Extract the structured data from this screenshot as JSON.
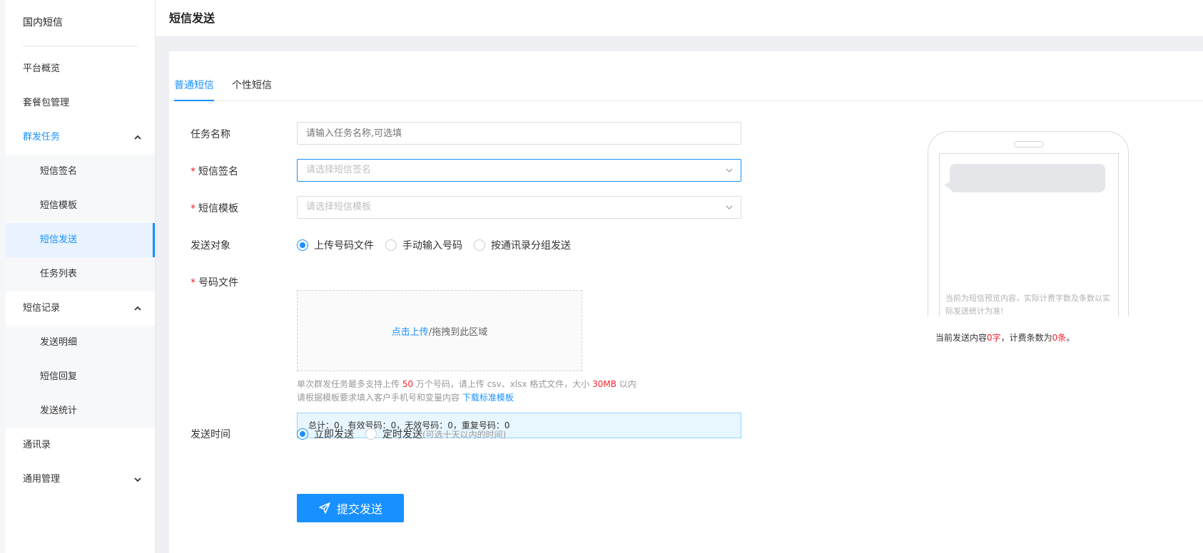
{
  "sidebar": {
    "title": "国内短信",
    "items": [
      {
        "label": "平台概览"
      },
      {
        "label": "套餐包管理"
      },
      {
        "label": "群发任务",
        "children": [
          "短信签名",
          "短信模板",
          "短信发送",
          "任务列表"
        ]
      },
      {
        "label": "短信记录",
        "children": [
          "发送明细",
          "短信回复",
          "发送统计"
        ]
      },
      {
        "label": "通讯录"
      },
      {
        "label": "通用管理"
      }
    ],
    "active_item": "短信发送"
  },
  "header": {
    "title": "短信发送"
  },
  "tabs": [
    {
      "label": "普通短信",
      "active": true
    },
    {
      "label": "个性短信",
      "active": false
    }
  ],
  "form": {
    "task_name": {
      "label": "任务名称",
      "placeholder": "请输入任务名称,可选填"
    },
    "signature": {
      "label": "短信签名",
      "placeholder": "请选择短信签名",
      "required_mark": "*"
    },
    "template": {
      "label": "短信模板",
      "placeholder": "请选择短信模板",
      "required_mark": "*"
    },
    "target": {
      "label": "发送对象",
      "options": [
        "上传号码文件",
        "手动输入号码",
        "按通讯录分组发送"
      ],
      "selected": "上传号码文件"
    },
    "number_file": {
      "label": "号码文件",
      "required_mark": "*",
      "upload_link": "点击上传",
      "upload_text": "/拖拽到此区域",
      "hint1_a": "单次群发任务最多支持上传 ",
      "hint1_num": "50",
      "hint1_b": " 万个号码，请上传 csv、xlsx 格式文件，大小 ",
      "hint1_size": "30MB",
      "hint1_c": " 以内",
      "hint2": "请根据模板要求填入客户手机号和变量内容 ",
      "download_link": "下载标准模板",
      "stats": "总计：0，有效号码：0，无效号码：0，重复号码：0"
    },
    "send_time": {
      "label": "发送时间",
      "options": [
        "立即发送",
        "定时发送"
      ],
      "schedule_hint": "(可选十天以内的时间)",
      "selected": "立即发送"
    },
    "submit_label": "提交发送"
  },
  "preview": {
    "note": "当前为短信预览内容，实际计费字数及条数以实际发送统计为准!",
    "count_a": "当前发送内容",
    "chars": "0字",
    "count_b": "，计费条数为",
    "bills": "0条",
    "count_c": "。"
  },
  "colors": {
    "accent": "#1890ff",
    "required": "#f5222d"
  }
}
